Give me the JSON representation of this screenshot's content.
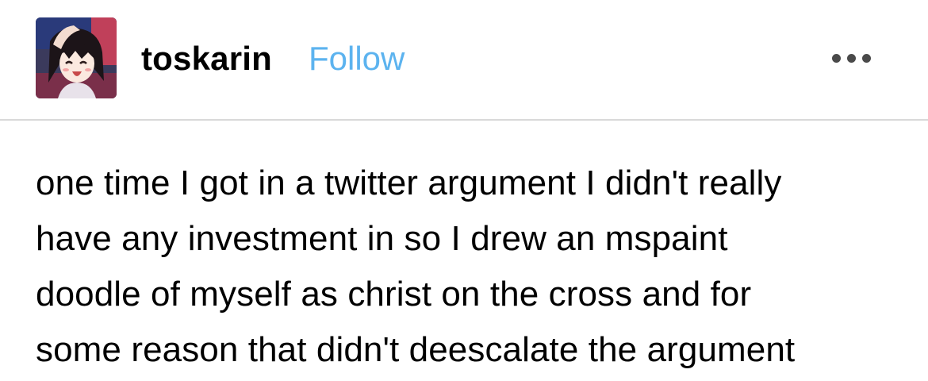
{
  "post": {
    "author": {
      "username": "toskarin",
      "follow_label": "Follow",
      "avatar_icon": "anime-girl-avatar-icon"
    },
    "more_icon": "ellipsis-icon",
    "body_lines": [
      "one time I got in a twitter argument I didn't really",
      "have any investment in so I drew an mspaint",
      "doodle of myself as christ on the cross and for",
      "some reason that didn't deescalate the argument"
    ]
  },
  "colors": {
    "follow_link": "#5cb3ef",
    "divider": "#d9d9d9",
    "text": "#000000",
    "more_dots": "#4a4a4a"
  }
}
